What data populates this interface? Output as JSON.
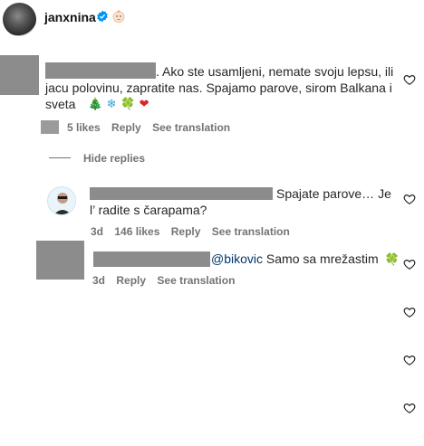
{
  "header": {
    "username": "janxnina",
    "icons": {
      "verified": "verified-badge-icon",
      "emoji": "baby-face-emoji"
    }
  },
  "comments": [
    {
      "text": ". Ako ste usamljeni, nemate svoju lepsu, ili jacu polovinu, zapratite nas. Spajamo parove, sirom Balkana i sveta",
      "line1": ". Ako ste usamljeni, nemate svoju lepsu, ili",
      "line2": "jacu polovinu, zapratite nas. Spajamo parove, sirom Balkana i",
      "line3": "sveta",
      "emojis": [
        "🎄",
        "❄",
        "🍀",
        "❤"
      ],
      "likes": "5 likes",
      "reply": "Reply",
      "translate": "See translation"
    }
  ],
  "hide_replies": "Hide replies",
  "replies": [
    {
      "line1": "Spajate parove… Je",
      "line2": "l’ radite s čarapama?",
      "time": "3d",
      "likes": "146 likes",
      "reply": "Reply",
      "translate": "See translation"
    },
    {
      "mention": "@bikovic",
      "text": "Samo sa mrežastim",
      "emoji": "🍀",
      "time": "3d",
      "reply": "Reply",
      "translate": "See translation"
    }
  ],
  "colors": {
    "text": "#262626",
    "secondary": "#737373",
    "mention": "#00376b",
    "verified": "#0095f6",
    "redaction": "#8c8c8c"
  }
}
